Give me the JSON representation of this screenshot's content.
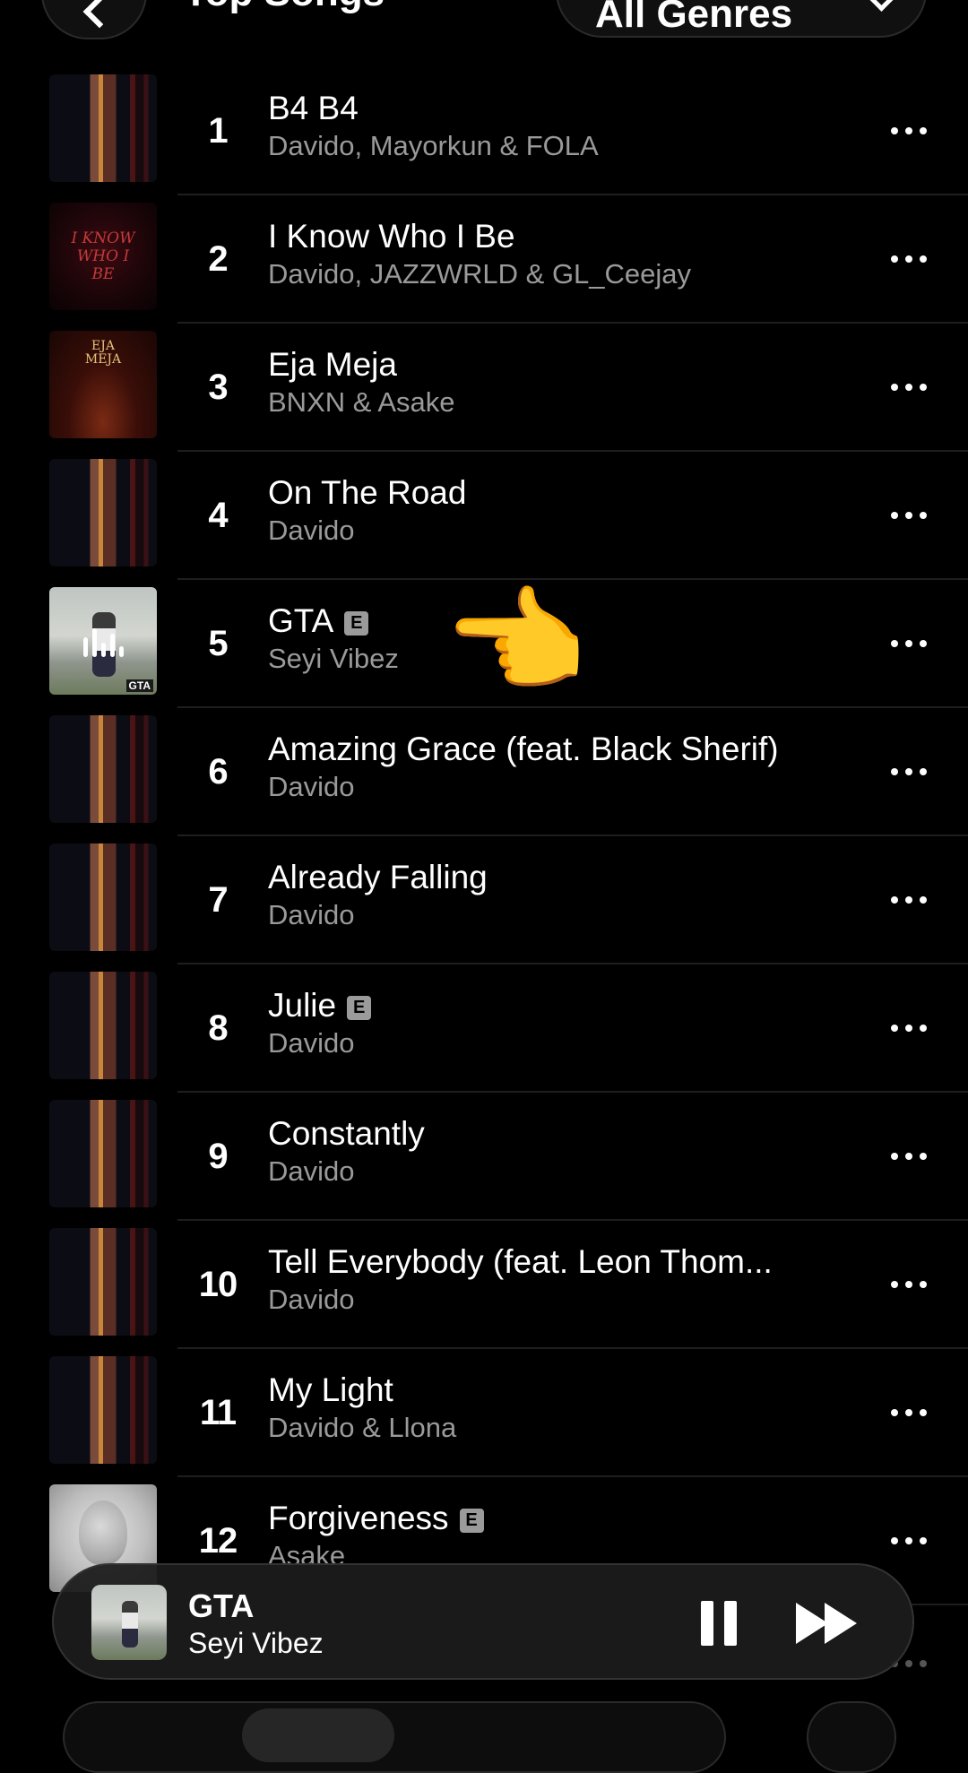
{
  "header": {
    "title": "Top Songs",
    "genre_filter": "All Genres"
  },
  "songs": [
    {
      "rank": "1",
      "title": "B4 B4",
      "artist": "Davido, Mayorkun & FOLA",
      "explicit": false,
      "art": "davido-album"
    },
    {
      "rank": "2",
      "title": "I Know Who I Be",
      "artist": "Davido, JAZZWRLD & GL_Ceejay",
      "explicit": false,
      "art": "i-know-who-i-be",
      "art_text": "I KNOW WHO I BE"
    },
    {
      "rank": "3",
      "title": "Eja Meja",
      "artist": "BNXN & Asake",
      "explicit": false,
      "art": "eja-meja",
      "art_text": "EJA MEJA"
    },
    {
      "rank": "4",
      "title": "On The Road",
      "artist": "Davido",
      "explicit": false,
      "art": "davido-album"
    },
    {
      "rank": "5",
      "title": "GTA",
      "artist": "Seyi Vibez",
      "explicit": true,
      "art": "gta",
      "now_playing": true,
      "art_text": "GTA"
    },
    {
      "rank": "6",
      "title": "Amazing Grace (feat. Black Sherif)",
      "artist": "Davido",
      "explicit": false,
      "art": "davido-album"
    },
    {
      "rank": "7",
      "title": "Already Falling",
      "artist": "Davido",
      "explicit": false,
      "art": "davido-album"
    },
    {
      "rank": "8",
      "title": "Julie",
      "artist": "Davido",
      "explicit": true,
      "art": "davido-album"
    },
    {
      "rank": "9",
      "title": "Constantly",
      "artist": "Davido",
      "explicit": false,
      "art": "davido-album"
    },
    {
      "rank": "10",
      "title": "Tell Everybody (feat. Leon Thom...",
      "artist": "Davido",
      "explicit": false,
      "art": "davido-album"
    },
    {
      "rank": "11",
      "title": "My Light",
      "artist": "Davido & Llona",
      "explicit": false,
      "art": "davido-album"
    },
    {
      "rank": "12",
      "title": "Forgiveness",
      "artist": "Asake",
      "explicit": true,
      "art": "forgiveness"
    }
  ],
  "explicit_badge": "E",
  "overlay": {
    "pointer_emoji": "👉",
    "points_at_rank": "5"
  },
  "now_playing": {
    "title": "GTA",
    "artist": "Seyi Vibez",
    "controls": [
      "pause-icon",
      "forward-icon"
    ]
  },
  "colors": {
    "background": "#000000",
    "secondary_text": "#9a9a9a",
    "explicit_badge_bg": "#9b9b9b",
    "divider": "#1e1e1e",
    "mini_player_bg": "#1c1c1c"
  }
}
